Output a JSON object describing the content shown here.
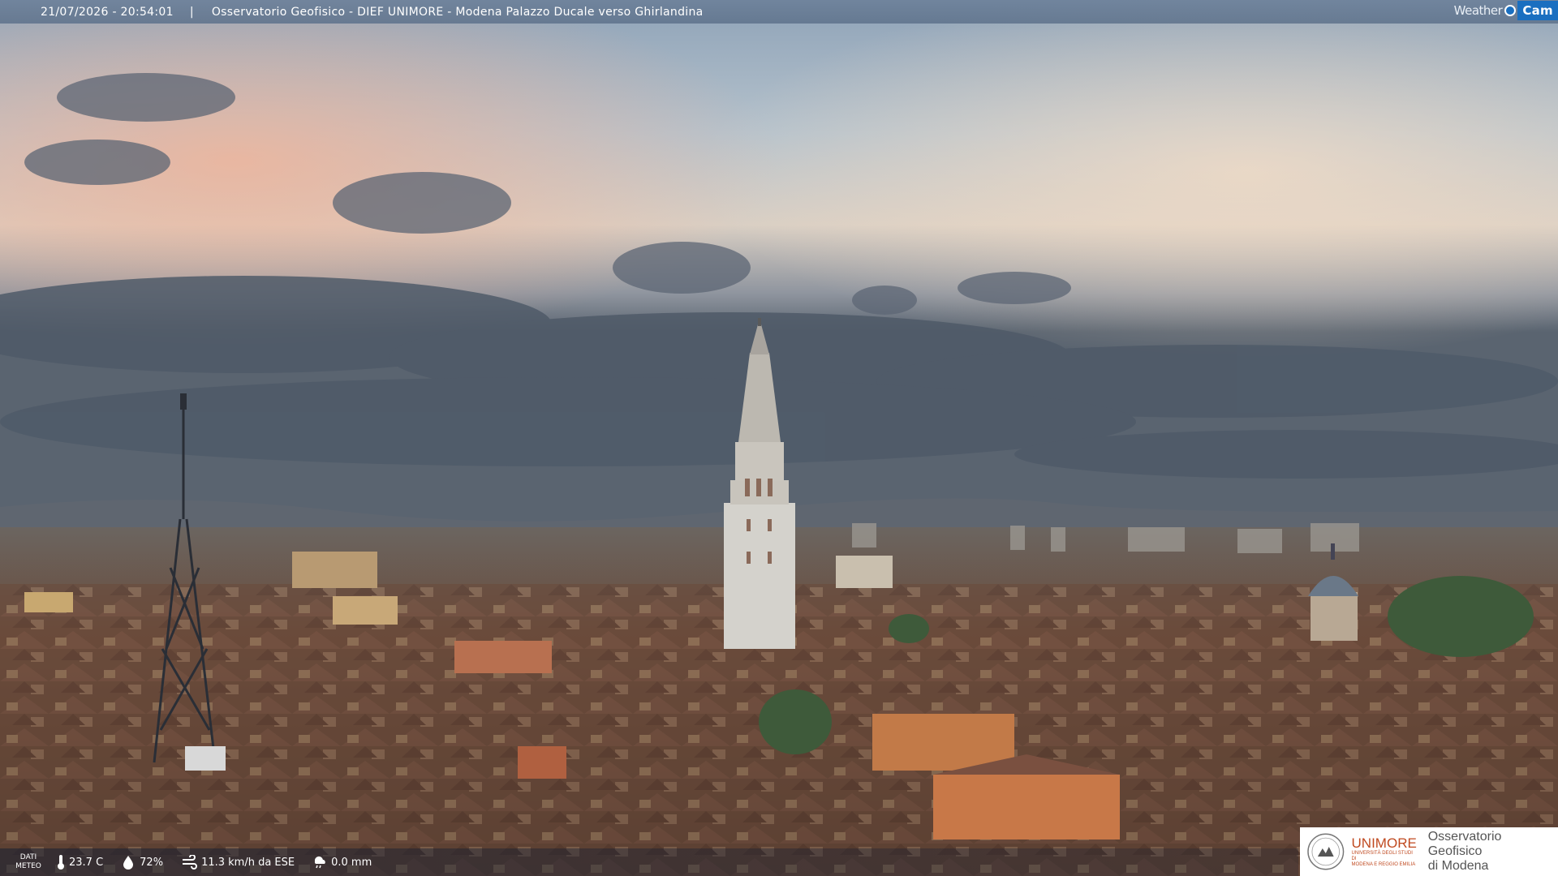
{
  "header": {
    "timestamp": "21/07/2026 - 20:54:01",
    "separator": "|",
    "title": "Osservatorio Geofisico - DIEF UNIMORE - Modena Palazzo Ducale verso Ghirlandina",
    "logo_weather": "Weather",
    "logo_cam": "Cam"
  },
  "weather": {
    "label_line1": "DATI",
    "label_line2": "METEO",
    "temperature": "23.7 C",
    "humidity": "72%",
    "wind": "11.3 km/h da ESE",
    "rain": "0.0 mm"
  },
  "branding": {
    "university": "UNIMORE",
    "university_sub1": "UNIVERSITÀ DEGLI STUDI DI",
    "university_sub2": "MODENA E REGGIO EMILIA",
    "observatory_line1": "Osservatorio Geofisico",
    "observatory_line2": "di Modena"
  },
  "colors": {
    "sky_top": "#7f93a8",
    "sky_peach": "#e8b8a0",
    "roofs": "#6a4a3a",
    "brand": "#c04a20",
    "logo_blue": "#1a6fc0"
  },
  "icons": {
    "temperature": "thermometer-icon",
    "humidity": "droplet-icon",
    "wind": "wind-icon",
    "rain": "rain-icon"
  }
}
